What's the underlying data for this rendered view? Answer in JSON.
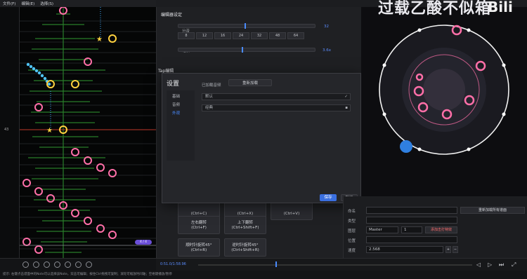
{
  "menu": [
    "文件(F)",
    "编辑(E)",
    "选择(S)"
  ],
  "chart": {
    "time_label": "43",
    "selection_badge": "4 / 4"
  },
  "editor_settings": {
    "title": "编辑器设定",
    "subdivision_label": "分音",
    "subdivision_value": "32",
    "subdivision_options": [
      "8",
      "12",
      "16",
      "24",
      "32",
      "48",
      "64"
    ],
    "speed_label": "缩放",
    "speed_value": "3.6x"
  },
  "tap_section": {
    "title": "Tap编辑"
  },
  "operations": [
    {
      "label": "",
      "shortcut": "(Ctrl+C)"
    },
    {
      "label": "",
      "shortcut": "(Ctrl+X)"
    },
    {
      "label": "",
      "shortcut": "(Ctrl+V)"
    },
    {
      "label": "左右翻转",
      "shortcut": "(Ctrl+F)"
    },
    {
      "label": "上下翻转",
      "shortcut": "(Ctrl+Shift+F)"
    },
    {
      "label": "顺时针旋转45°",
      "shortcut": "(Ctrl+R)"
    },
    {
      "label": "逆时针旋转45°",
      "shortcut": "(Ctrl+Shift+R)"
    }
  ],
  "operations_label": "操作",
  "dialog": {
    "title": "设置",
    "nav": [
      "基础",
      "音频",
      "外观"
    ],
    "loaded_text": "已加载音频",
    "reload_button": "重新加载",
    "field1": "默认",
    "field2": "经典",
    "save": "保存",
    "cancel": "取消"
  },
  "overlay_text": "过载乙酸不似箱",
  "logo_text": "Bili",
  "properties": {
    "name_label": "命名",
    "type_label": "类型",
    "layer_label": "图层",
    "position_label": "位置",
    "speed_label": "速度",
    "timing_value": "Master",
    "timing_index": "1",
    "speed_value": "2.568",
    "apply_button": "重新加载所有谱面",
    "add_button": "添加击打特效"
  },
  "playback": {
    "time": "0:51.0/1:58.96"
  },
  "status_text": "提示: 右键点击谱面中的Note可以选择该Note，双击可编辑；按住Ctrl拖拽可复制；滚轮可缩放时间轴；空格键播放/暂停"
}
